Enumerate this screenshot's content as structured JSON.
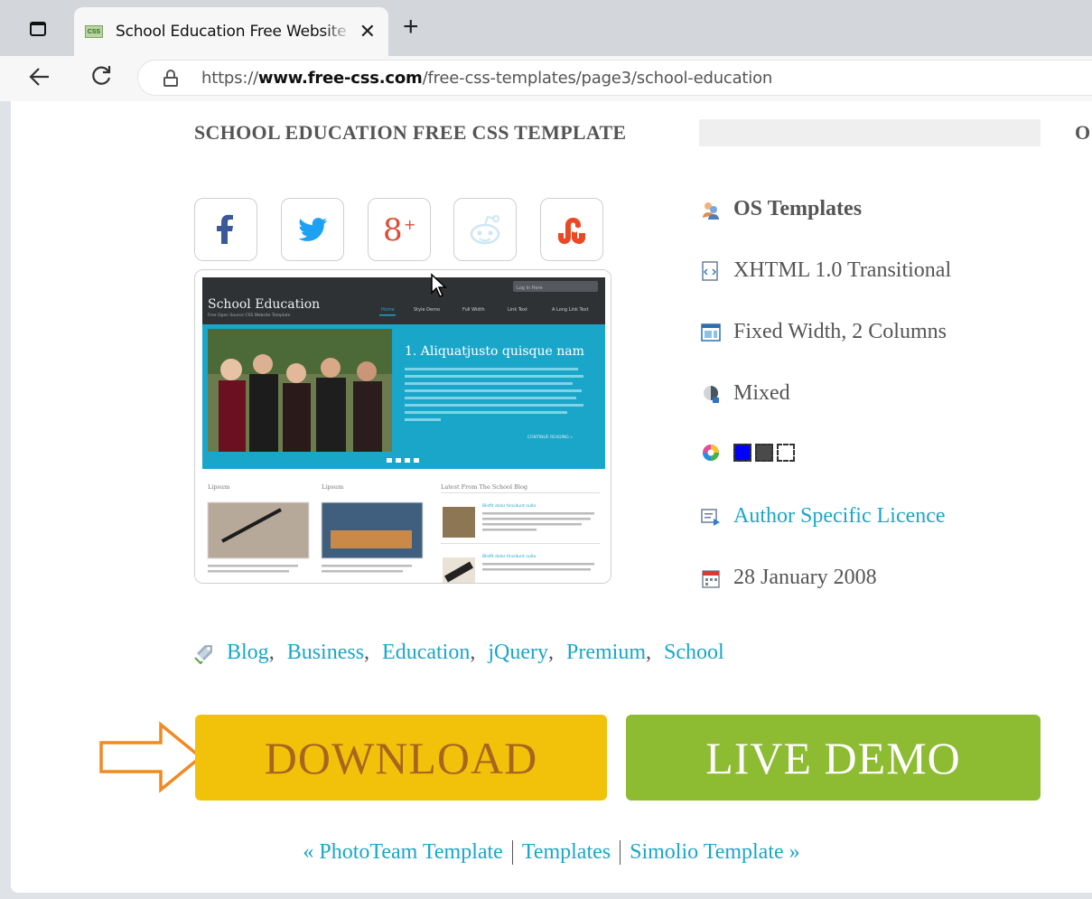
{
  "browser": {
    "tab_title": "School Education Free Website Te",
    "tab_favicon": "CSS",
    "url_scheme": "https://",
    "url_host": "www.free-css.com",
    "url_path": "/free-css-templates/page3/school-education"
  },
  "page": {
    "title": "SCHOOL EDUCATION FREE CSS TEMPLATE",
    "title_edge": "O"
  },
  "social": [
    {
      "name": "facebook-icon",
      "color": "#3b5998"
    },
    {
      "name": "twitter-icon",
      "color": "#1da1f2"
    },
    {
      "name": "google-plus-icon",
      "color": "#dd4b39"
    },
    {
      "name": "reddit-icon",
      "color": "#cde6f5"
    },
    {
      "name": "stumbleupon-icon",
      "color": "#eb4924"
    }
  ],
  "preview": {
    "site_name": "School Education",
    "tagline": "Free Open Source CSS Website Template",
    "login_text": "Log In Here",
    "nav": [
      "Home",
      "Style Demo",
      "Full Width",
      "Link Text",
      "A Long Link Text"
    ],
    "slide_heading": "1. Aliquatjusto quisque nam",
    "slide_more": "CONTINUE READING »",
    "col1_heading": "Lipsum",
    "col2_heading": "Lipsum",
    "col3_heading": "Latest From The School Blog",
    "blog_item_title": "Blisfit dolor tincidunt nulla"
  },
  "meta": {
    "author": "OS Templates",
    "doctype": "XHTML 1.0 Transitional",
    "layout": "Fixed Width, 2 Columns",
    "style": "Mixed",
    "licence": "Author Specific Licence",
    "date": "28 January 2008",
    "swatches": [
      "#0000ff",
      "#4a4a4a",
      "#ffffff",
      "#ffffff"
    ]
  },
  "tags": [
    "Blog",
    "Business",
    "Education",
    "jQuery",
    "Premium",
    "School"
  ],
  "tag_separator": ",",
  "buttons": {
    "download": "DOWNLOAD",
    "live_demo": "LIVE DEMO"
  },
  "pager": {
    "prev": "« PhotoTeam Template",
    "index": "Templates",
    "next": "Simolio Template »"
  }
}
